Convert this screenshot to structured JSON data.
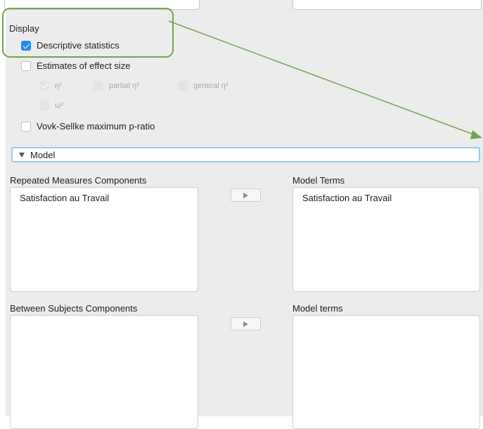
{
  "display": {
    "heading": "Display",
    "descriptive_statistics": {
      "label": "Descriptive statistics",
      "checked": true
    },
    "effect_size": {
      "label": "Estimates of effect size",
      "checked": false
    },
    "eta_sq": {
      "label": "η²",
      "checked": true,
      "disabled": true
    },
    "partial_eta_sq": {
      "label": "partial η²",
      "checked": false,
      "disabled": true
    },
    "general_eta_sq": {
      "label": "general η²",
      "checked": false,
      "disabled": true
    },
    "omega_sq": {
      "label": "ω²",
      "checked": false,
      "disabled": true
    },
    "vovk_sellke": {
      "label": "Vovk-Sellke maximum p-ratio",
      "checked": false
    }
  },
  "model": {
    "header": "Model",
    "repeated_measures": {
      "label": "Repeated Measures Components",
      "items": [
        "Satisfaction au Travail"
      ]
    },
    "model_terms": {
      "label": "Model Terms",
      "items": [
        "Satisfaction au Travail"
      ]
    },
    "between_subjects": {
      "label": "Between Subjects Components",
      "items": []
    },
    "model_terms_between": {
      "label": "Model terms",
      "items": []
    }
  },
  "colors": {
    "accent": "#1a8cf0",
    "annotation": "#6fa64d",
    "focus_border": "#9ec7ee"
  },
  "icons": {
    "move_right": "triangle-right-icon",
    "collapse": "triangle-down-icon"
  }
}
